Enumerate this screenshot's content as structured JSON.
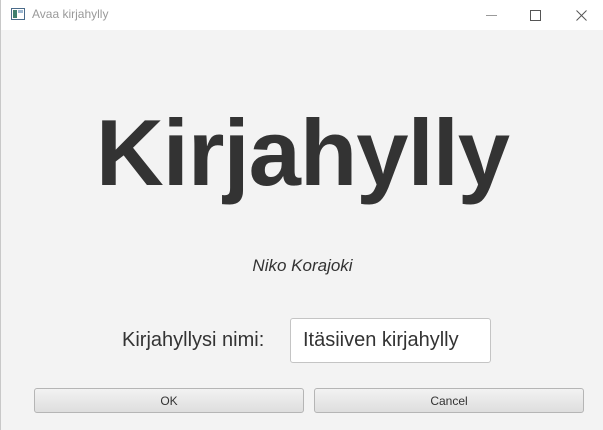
{
  "window": {
    "title": "Avaa kirjahylly"
  },
  "heading": {
    "title": "Kirjahylly",
    "author": "Niko Korajoki"
  },
  "form": {
    "name_label": "Kirjahyllysi nimi:",
    "name_value": "Itäsiiven kirjahylly"
  },
  "buttons": {
    "ok_label": "OK",
    "cancel_label": "Cancel"
  },
  "colors": {
    "window_bg": "#f3f3f3",
    "text": "#333333",
    "titlebar_text": "#9a9a9a"
  },
  "icons": [
    "app-icon",
    "minimize-icon",
    "maximize-icon",
    "close-icon"
  ]
}
